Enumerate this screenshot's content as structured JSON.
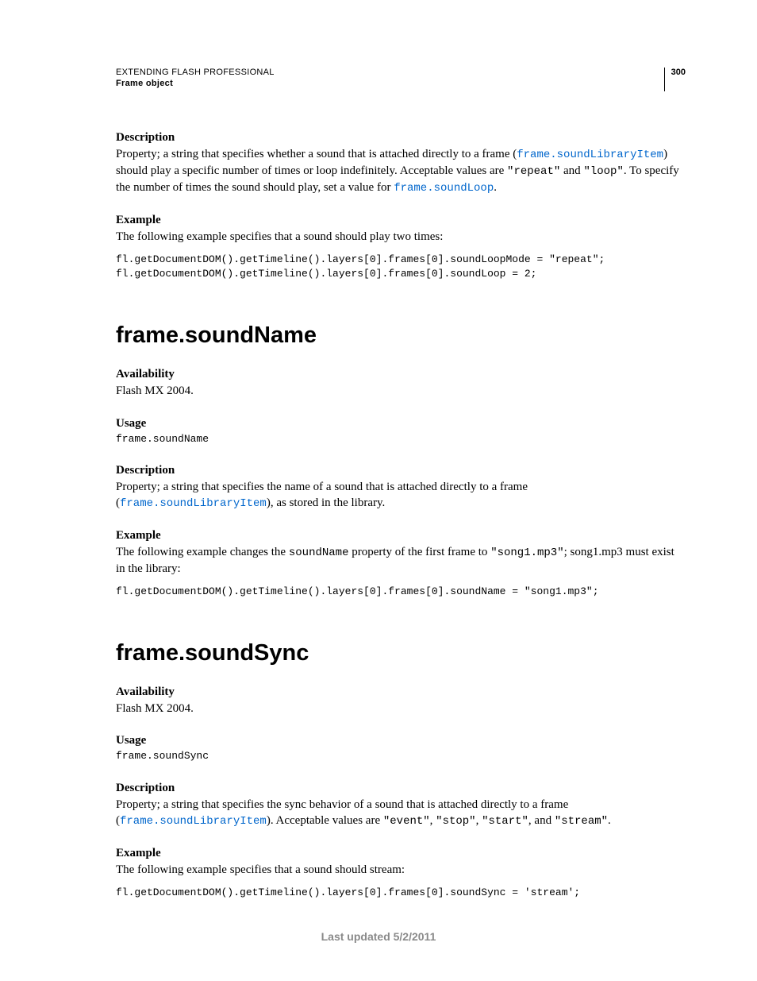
{
  "header": {
    "title": "EXTENDING FLASH PROFESSIONAL",
    "subtitle": "Frame object",
    "page_number": "300"
  },
  "sec1": {
    "h_desc": "Description",
    "desc_p1a": "Property; a string that specifies whether a sound that is attached directly to a frame (",
    "desc_link1": "frame.soundLibraryItem",
    "desc_p1b": ") should play a specific number of times or loop indefinitely. Acceptable values are ",
    "desc_repeat": "\"repeat\"",
    "desc_and": " and ",
    "desc_loop": "\"loop\"",
    "desc_p1c": ". To specify the number of times the sound should play, set a value for ",
    "desc_link2": "frame.soundLoop",
    "desc_p1d": ".",
    "h_example": "Example",
    "example_intro": "The following example specifies that a sound should play two times:",
    "code": "fl.getDocumentDOM().getTimeline().layers[0].frames[0].soundLoopMode = \"repeat\";\nfl.getDocumentDOM().getTimeline().layers[0].frames[0].soundLoop = 2;"
  },
  "sec2": {
    "title": "frame.soundName",
    "h_avail": "Availability",
    "avail": "Flash MX 2004.",
    "h_usage": "Usage",
    "usage": "frame.soundName",
    "h_desc": "Description",
    "desc_a": "Property; a string that specifies the name of a sound that is attached directly to a frame (",
    "desc_link": "frame.soundLibraryItem",
    "desc_b": "), as stored in the library.",
    "h_example": "Example",
    "ex_a": "The following example changes the ",
    "ex_mono1": "soundName",
    "ex_b": " property of the first frame to ",
    "ex_mono2": "\"song1.mp3\"",
    "ex_c": "; song1.mp3 must exist in the library:",
    "code": "fl.getDocumentDOM().getTimeline().layers[0].frames[0].soundName = \"song1.mp3\";"
  },
  "sec3": {
    "title": "frame.soundSync",
    "h_avail": "Availability",
    "avail": "Flash MX 2004.",
    "h_usage": "Usage",
    "usage": "frame.soundSync",
    "h_desc": "Description",
    "desc_a": "Property; a string that specifies the sync behavior of a sound that is attached directly to a frame (",
    "desc_link": "frame.soundLibraryItem",
    "desc_b": "). Acceptable values are ",
    "v1": "\"event\"",
    "c1": ", ",
    "v2": "\"stop\"",
    "c2": ", ",
    "v3": "\"start\"",
    "c3": ", and ",
    "v4": "\"stream\"",
    "c4": ".",
    "h_example": "Example",
    "ex_intro": "The following example specifies that a sound should stream:",
    "code": "fl.getDocumentDOM().getTimeline().layers[0].frames[0].soundSync = 'stream';"
  },
  "footer": "Last updated 5/2/2011"
}
